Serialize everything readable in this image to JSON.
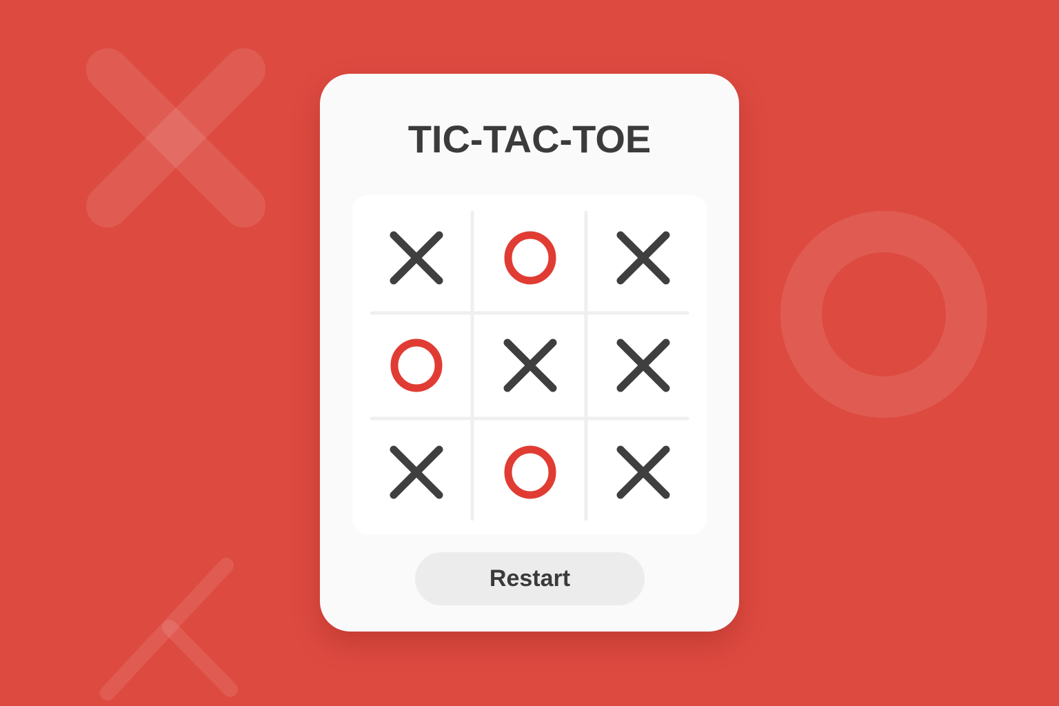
{
  "game": {
    "title": "TIC-TAC-TOE",
    "restart_label": "Restart",
    "board": [
      [
        "X",
        "O",
        "X"
      ],
      [
        "O",
        "X",
        "X"
      ],
      [
        "X",
        "O",
        "X"
      ]
    ]
  },
  "colors": {
    "background": "#dd4a40",
    "x_mark": "#3f3f3f",
    "o_mark": "#e03c33",
    "card": "#fafafa",
    "grid_line": "#efefef"
  },
  "decorations": [
    "x-shape",
    "o-shape",
    "x-shape"
  ]
}
